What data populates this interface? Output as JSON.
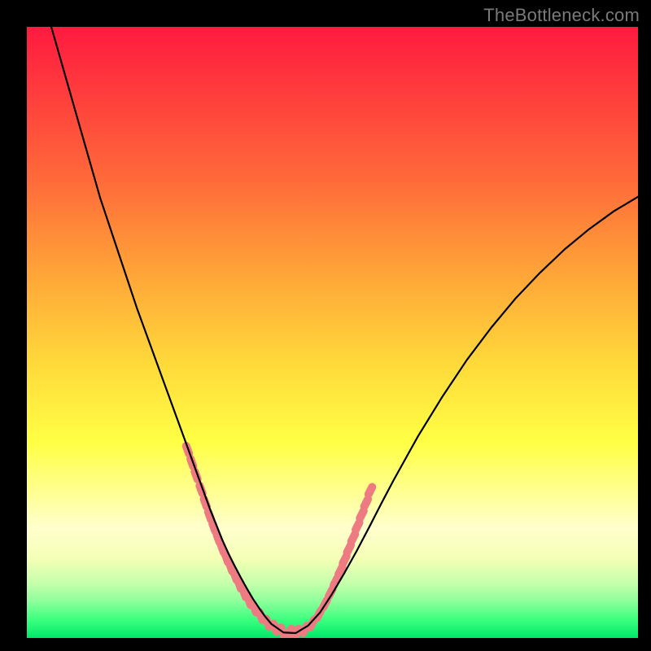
{
  "watermark": "TheBottleneck.com",
  "colors": {
    "frame": "#000000",
    "gradient_top": "#ff1a3f",
    "gradient_bottom": "#00e86a",
    "curve": "#000000",
    "markers": "#ef7b82"
  },
  "chart_data": {
    "type": "line",
    "title": "",
    "xlabel": "",
    "ylabel": "",
    "xlim": [
      0,
      100
    ],
    "ylim": [
      0,
      100
    ],
    "grid": false,
    "legend": false,
    "series": [
      {
        "name": "curve",
        "x": [
          4,
          6,
          8,
          10,
          12,
          14,
          16,
          18,
          20,
          22,
          24,
          26,
          28,
          30,
          31,
          32,
          33,
          34,
          35,
          36,
          37,
          38,
          39,
          40,
          42,
          44,
          46,
          48,
          50,
          52,
          54,
          56,
          58,
          60,
          64,
          68,
          72,
          76,
          80,
          84,
          88,
          92,
          96,
          100
        ],
        "y": [
          100,
          93,
          86,
          79,
          72,
          66,
          60,
          54,
          48.5,
          43,
          37.5,
          32,
          26.5,
          21,
          18.5,
          16,
          13.8,
          11.8,
          9.9,
          8.1,
          6.4,
          4.9,
          3.5,
          2.3,
          0.9,
          0.8,
          2.0,
          4.2,
          7.3,
          10.7,
          14.3,
          18.1,
          22.0,
          25.8,
          33.0,
          39.5,
          45.5,
          50.8,
          55.6,
          59.8,
          63.6,
          66.9,
          69.8,
          72.2
        ]
      }
    ],
    "markers": {
      "name": "highlight-dots",
      "color": "#ef7b82",
      "x": [
        26.3,
        27.0,
        27.7,
        28.5,
        29.2,
        29.9,
        30.6,
        31.3,
        32.0,
        32.7,
        33.4,
        34.1,
        34.8,
        35.6,
        36.4,
        37.3,
        38.3,
        39.4,
        40.6,
        41.8,
        43.0,
        44.2,
        45.5,
        46.7,
        47.8,
        48.8,
        49.7,
        50.5,
        51.3,
        52.0,
        52.7,
        53.4,
        54.1,
        54.8,
        55.5,
        56.2
      ],
      "y": [
        30.8,
        28.7,
        26.6,
        24.3,
        22.1,
        20.0,
        18.1,
        16.3,
        14.6,
        13.0,
        11.5,
        10.1,
        8.7,
        7.3,
        6.0,
        4.8,
        3.6,
        2.5,
        1.7,
        1.1,
        0.9,
        0.9,
        1.4,
        2.4,
        3.9,
        5.6,
        7.4,
        9.2,
        11.0,
        12.8,
        14.6,
        16.4,
        18.3,
        20.2,
        22.1,
        24.1
      ]
    }
  }
}
